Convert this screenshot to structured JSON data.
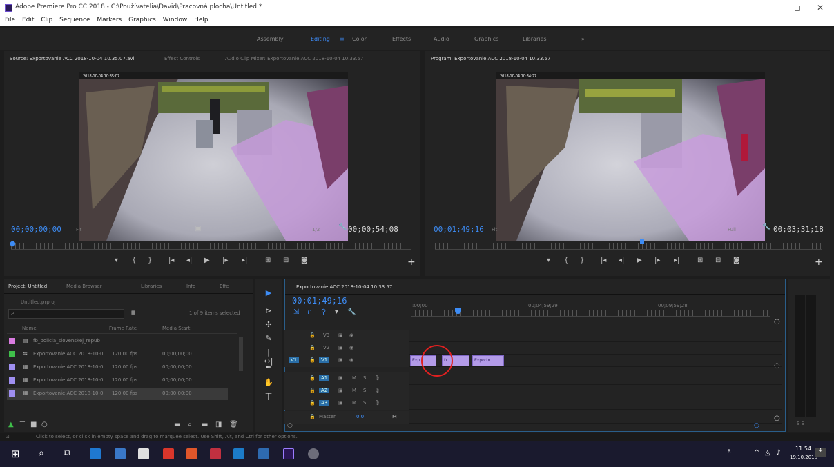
{
  "window": {
    "title": "Adobe Premiere Pro CC 2018 - C:\\Používatelia\\David\\Pracovná plocha\\Untitled *",
    "minimize": "–",
    "maximize": "◻",
    "close": "✕"
  },
  "menu": [
    "File",
    "Edit",
    "Clip",
    "Sequence",
    "Markers",
    "Graphics",
    "Window",
    "Help"
  ],
  "workspaces": {
    "items": [
      "Assembly",
      "Editing",
      "Color",
      "Effects",
      "Audio",
      "Graphics",
      "Libraries"
    ],
    "active": "Editing",
    "menu_glyph": "≡",
    "more": "»"
  },
  "source_monitor": {
    "tabs": [
      "Source: Exportovanie ACC 2018-10-04 10.35.07.avi",
      "Effect Controls",
      "Audio Clip Mixer: Exportovanie ACC 2018-10-04 10.33.57"
    ],
    "current_tc": "00;00;00;00",
    "fit": "Fit",
    "resolution": "1/2",
    "duration_tc": "00;00;54;08",
    "overlay_text": "2018-10-04 10:35:07"
  },
  "program_monitor": {
    "tab": "Program: Exportovanie ACC 2018-10-04 10.33.57",
    "current_tc": "00;01;49;16",
    "fit": "Fit",
    "resolution": "Full",
    "duration_tc": "00;03;31;18",
    "overlay_text": "2018-10-04 10:34:27",
    "playhead_fraction": 0.53
  },
  "transport_icons": [
    "marker-icon",
    "mark-in-icon",
    "mark-out-icon",
    "go-to-in-icon",
    "step-back-icon",
    "play-icon",
    "step-forward-icon",
    "go-to-out-icon",
    "insert-icon",
    "overwrite-icon",
    "export-frame-icon"
  ],
  "project": {
    "tabs": [
      "Project: Untitled",
      "Media Browser",
      "Libraries",
      "Info",
      "Effe"
    ],
    "file": "Untitled.prproj",
    "items_selected": "1 of 9 items selected",
    "columns": [
      "Name",
      "Frame Rate",
      "Media Start"
    ],
    "rows": [
      {
        "name": "fb_policia_slovenskej_repub",
        "rate": "",
        "start": "",
        "color": "#d97be0",
        "icon": "bin-icon"
      },
      {
        "name": "Exportovanie ACC 2018-10-0",
        "rate": "120,00 fps",
        "start": "00;00;00;00",
        "color": "#3fbf4a",
        "icon": "sequence-icon"
      },
      {
        "name": "Exportovanie ACC 2018-10-0",
        "rate": "120,00 fps",
        "start": "00;00;00;00",
        "color": "#9f8ff0",
        "icon": "clip-icon"
      },
      {
        "name": "Exportovanie ACC 2018-10-0",
        "rate": "120,00 fps",
        "start": "00;00;00;00",
        "color": "#9f8ff0",
        "icon": "clip-icon"
      },
      {
        "name": "Exportovanie ACC 2018-10-0",
        "rate": "120,00 fps",
        "start": "00;00;00;00",
        "color": "#9f8ff0",
        "icon": "clip-icon"
      }
    ]
  },
  "timeline": {
    "tab": "Exportovanie ACC 2018-10-04 10.33.57",
    "current_tc": "00;01;49;16",
    "ruler_labels": [
      ":00;00",
      "00;04;59;29",
      "00;09;59;28"
    ],
    "video_tracks": [
      "V3",
      "V2",
      "V1"
    ],
    "audio_tracks": [
      "A1",
      "A2",
      "A3"
    ],
    "master": "Master",
    "master_value": "0,0",
    "clips": [
      {
        "label": "Exp",
        "track": "V1"
      },
      {
        "label": "fx",
        "track": "V1"
      },
      {
        "label": "Exporto",
        "track": "V1"
      }
    ]
  },
  "status_bar": "Click to select, or click in empty space and drag to marquee select. Use Shift, Alt, and Ctrl for other options.",
  "taskbar": {
    "time": "11:54",
    "date": "19.10.2018",
    "notification_count": "4"
  }
}
